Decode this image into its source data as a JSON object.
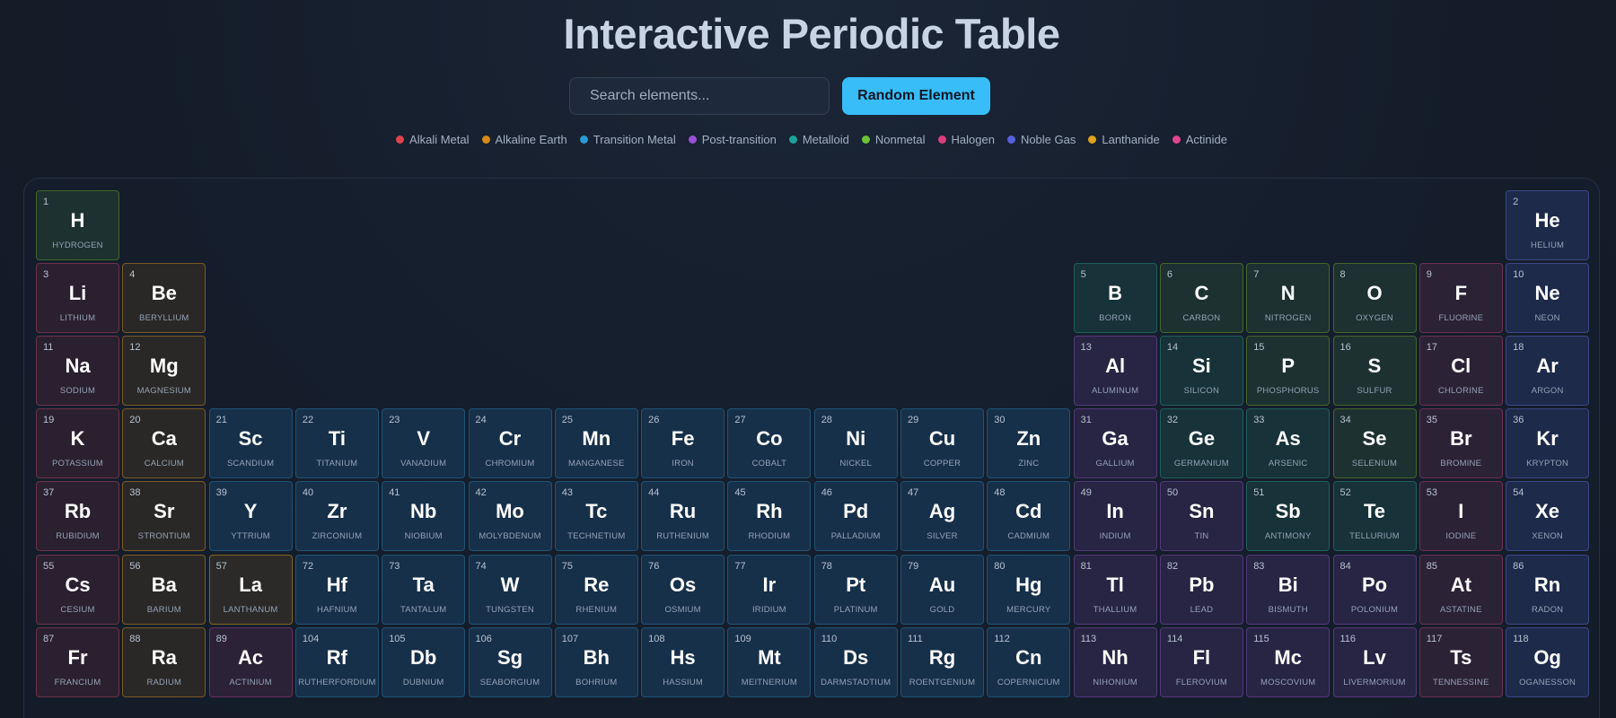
{
  "title": "Interactive Periodic Table",
  "search": {
    "placeholder": "Search elements..."
  },
  "random_button_label": "Random Element",
  "legend": [
    {
      "label": "Alkali Metal",
      "color": "#e0434e"
    },
    {
      "label": "Alkaline Earth",
      "color": "#d68a17"
    },
    {
      "label": "Transition Metal",
      "color": "#2c9ad6"
    },
    {
      "label": "Post-transition",
      "color": "#9b4fd8"
    },
    {
      "label": "Metalloid",
      "color": "#1ba39a"
    },
    {
      "label": "Nonmetal",
      "color": "#6cc23a"
    },
    {
      "label": "Halogen",
      "color": "#db3f7c"
    },
    {
      "label": "Noble Gas",
      "color": "#5560e0"
    },
    {
      "label": "Lanthanide",
      "color": "#e0a21b"
    },
    {
      "label": "Actinide",
      "color": "#e0458e"
    }
  ],
  "elements": [
    {
      "num": "1",
      "sym": "H",
      "name": "HYDROGEN",
      "cat": "nonmetal",
      "row": 1,
      "col": 1
    },
    {
      "num": "2",
      "sym": "He",
      "name": "HELIUM",
      "cat": "noble",
      "row": 1,
      "col": 18
    },
    {
      "num": "3",
      "sym": "Li",
      "name": "LITHIUM",
      "cat": "alkali",
      "row": 2,
      "col": 1
    },
    {
      "num": "4",
      "sym": "Be",
      "name": "BERYLLIUM",
      "cat": "alkaline",
      "row": 2,
      "col": 2
    },
    {
      "num": "5",
      "sym": "B",
      "name": "BORON",
      "cat": "metalloid",
      "row": 2,
      "col": 13
    },
    {
      "num": "6",
      "sym": "C",
      "name": "CARBON",
      "cat": "nonmetal",
      "row": 2,
      "col": 14
    },
    {
      "num": "7",
      "sym": "N",
      "name": "NITROGEN",
      "cat": "nonmetal",
      "row": 2,
      "col": 15
    },
    {
      "num": "8",
      "sym": "O",
      "name": "OXYGEN",
      "cat": "nonmetal",
      "row": 2,
      "col": 16
    },
    {
      "num": "9",
      "sym": "F",
      "name": "FLUORINE",
      "cat": "halogen",
      "row": 2,
      "col": 17
    },
    {
      "num": "10",
      "sym": "Ne",
      "name": "NEON",
      "cat": "noble",
      "row": 2,
      "col": 18
    },
    {
      "num": "11",
      "sym": "Na",
      "name": "SODIUM",
      "cat": "alkali",
      "row": 3,
      "col": 1
    },
    {
      "num": "12",
      "sym": "Mg",
      "name": "MAGNESIUM",
      "cat": "alkaline",
      "row": 3,
      "col": 2
    },
    {
      "num": "13",
      "sym": "Al",
      "name": "ALUMINUM",
      "cat": "post",
      "row": 3,
      "col": 13
    },
    {
      "num": "14",
      "sym": "Si",
      "name": "SILICON",
      "cat": "metalloid",
      "row": 3,
      "col": 14
    },
    {
      "num": "15",
      "sym": "P",
      "name": "PHOSPHORUS",
      "cat": "nonmetal",
      "row": 3,
      "col": 15
    },
    {
      "num": "16",
      "sym": "S",
      "name": "SULFUR",
      "cat": "nonmetal",
      "row": 3,
      "col": 16
    },
    {
      "num": "17",
      "sym": "Cl",
      "name": "CHLORINE",
      "cat": "halogen",
      "row": 3,
      "col": 17
    },
    {
      "num": "18",
      "sym": "Ar",
      "name": "ARGON",
      "cat": "noble",
      "row": 3,
      "col": 18
    },
    {
      "num": "19",
      "sym": "K",
      "name": "POTASSIUM",
      "cat": "alkali",
      "row": 4,
      "col": 1
    },
    {
      "num": "20",
      "sym": "Ca",
      "name": "CALCIUM",
      "cat": "alkaline",
      "row": 4,
      "col": 2
    },
    {
      "num": "21",
      "sym": "Sc",
      "name": "SCANDIUM",
      "cat": "transition",
      "row": 4,
      "col": 3
    },
    {
      "num": "22",
      "sym": "Ti",
      "name": "TITANIUM",
      "cat": "transition",
      "row": 4,
      "col": 4
    },
    {
      "num": "23",
      "sym": "V",
      "name": "VANADIUM",
      "cat": "transition",
      "row": 4,
      "col": 5
    },
    {
      "num": "24",
      "sym": "Cr",
      "name": "CHROMIUM",
      "cat": "transition",
      "row": 4,
      "col": 6
    },
    {
      "num": "25",
      "sym": "Mn",
      "name": "MANGANESE",
      "cat": "transition",
      "row": 4,
      "col": 7
    },
    {
      "num": "26",
      "sym": "Fe",
      "name": "IRON",
      "cat": "transition",
      "row": 4,
      "col": 8
    },
    {
      "num": "27",
      "sym": "Co",
      "name": "COBALT",
      "cat": "transition",
      "row": 4,
      "col": 9
    },
    {
      "num": "28",
      "sym": "Ni",
      "name": "NICKEL",
      "cat": "transition",
      "row": 4,
      "col": 10
    },
    {
      "num": "29",
      "sym": "Cu",
      "name": "COPPER",
      "cat": "transition",
      "row": 4,
      "col": 11
    },
    {
      "num": "30",
      "sym": "Zn",
      "name": "ZINC",
      "cat": "transition",
      "row": 4,
      "col": 12
    },
    {
      "num": "31",
      "sym": "Ga",
      "name": "GALLIUM",
      "cat": "post",
      "row": 4,
      "col": 13
    },
    {
      "num": "32",
      "sym": "Ge",
      "name": "GERMANIUM",
      "cat": "metalloid",
      "row": 4,
      "col": 14
    },
    {
      "num": "33",
      "sym": "As",
      "name": "ARSENIC",
      "cat": "metalloid",
      "row": 4,
      "col": 15
    },
    {
      "num": "34",
      "sym": "Se",
      "name": "SELENIUM",
      "cat": "nonmetal",
      "row": 4,
      "col": 16
    },
    {
      "num": "35",
      "sym": "Br",
      "name": "BROMINE",
      "cat": "halogen",
      "row": 4,
      "col": 17
    },
    {
      "num": "36",
      "sym": "Kr",
      "name": "KRYPTON",
      "cat": "noble",
      "row": 4,
      "col": 18
    },
    {
      "num": "37",
      "sym": "Rb",
      "name": "RUBIDIUM",
      "cat": "alkali",
      "row": 5,
      "col": 1
    },
    {
      "num": "38",
      "sym": "Sr",
      "name": "STRONTIUM",
      "cat": "alkaline",
      "row": 5,
      "col": 2
    },
    {
      "num": "39",
      "sym": "Y",
      "name": "YTTRIUM",
      "cat": "transition",
      "row": 5,
      "col": 3
    },
    {
      "num": "40",
      "sym": "Zr",
      "name": "ZIRCONIUM",
      "cat": "transition",
      "row": 5,
      "col": 4
    },
    {
      "num": "41",
      "sym": "Nb",
      "name": "NIOBIUM",
      "cat": "transition",
      "row": 5,
      "col": 5
    },
    {
      "num": "42",
      "sym": "Mo",
      "name": "MOLYBDENUM",
      "cat": "transition",
      "row": 5,
      "col": 6
    },
    {
      "num": "43",
      "sym": "Tc",
      "name": "TECHNETIUM",
      "cat": "transition",
      "row": 5,
      "col": 7
    },
    {
      "num": "44",
      "sym": "Ru",
      "name": "RUTHENIUM",
      "cat": "transition",
      "row": 5,
      "col": 8
    },
    {
      "num": "45",
      "sym": "Rh",
      "name": "RHODIUM",
      "cat": "transition",
      "row": 5,
      "col": 9
    },
    {
      "num": "46",
      "sym": "Pd",
      "name": "PALLADIUM",
      "cat": "transition",
      "row": 5,
      "col": 10
    },
    {
      "num": "47",
      "sym": "Ag",
      "name": "SILVER",
      "cat": "transition",
      "row": 5,
      "col": 11
    },
    {
      "num": "48",
      "sym": "Cd",
      "name": "CADMIUM",
      "cat": "transition",
      "row": 5,
      "col": 12
    },
    {
      "num": "49",
      "sym": "In",
      "name": "INDIUM",
      "cat": "post",
      "row": 5,
      "col": 13
    },
    {
      "num": "50",
      "sym": "Sn",
      "name": "TIN",
      "cat": "post",
      "row": 5,
      "col": 14
    },
    {
      "num": "51",
      "sym": "Sb",
      "name": "ANTIMONY",
      "cat": "metalloid",
      "row": 5,
      "col": 15
    },
    {
      "num": "52",
      "sym": "Te",
      "name": "TELLURIUM",
      "cat": "metalloid",
      "row": 5,
      "col": 16
    },
    {
      "num": "53",
      "sym": "I",
      "name": "IODINE",
      "cat": "halogen",
      "row": 5,
      "col": 17
    },
    {
      "num": "54",
      "sym": "Xe",
      "name": "XENON",
      "cat": "noble",
      "row": 5,
      "col": 18
    },
    {
      "num": "55",
      "sym": "Cs",
      "name": "CESIUM",
      "cat": "alkali",
      "row": 6,
      "col": 1
    },
    {
      "num": "56",
      "sym": "Ba",
      "name": "BARIUM",
      "cat": "alkaline",
      "row": 6,
      "col": 2
    },
    {
      "num": "57",
      "sym": "La",
      "name": "LANTHANUM",
      "cat": "lanthanide",
      "row": 6,
      "col": 3
    },
    {
      "num": "72",
      "sym": "Hf",
      "name": "HAFNIUM",
      "cat": "transition",
      "row": 6,
      "col": 4
    },
    {
      "num": "73",
      "sym": "Ta",
      "name": "TANTALUM",
      "cat": "transition",
      "row": 6,
      "col": 5
    },
    {
      "num": "74",
      "sym": "W",
      "name": "TUNGSTEN",
      "cat": "transition",
      "row": 6,
      "col": 6
    },
    {
      "num": "75",
      "sym": "Re",
      "name": "RHENIUM",
      "cat": "transition",
      "row": 6,
      "col": 7
    },
    {
      "num": "76",
      "sym": "Os",
      "name": "OSMIUM",
      "cat": "transition",
      "row": 6,
      "col": 8
    },
    {
      "num": "77",
      "sym": "Ir",
      "name": "IRIDIUM",
      "cat": "transition",
      "row": 6,
      "col": 9
    },
    {
      "num": "78",
      "sym": "Pt",
      "name": "PLATINUM",
      "cat": "transition",
      "row": 6,
      "col": 10
    },
    {
      "num": "79",
      "sym": "Au",
      "name": "GOLD",
      "cat": "transition",
      "row": 6,
      "col": 11
    },
    {
      "num": "80",
      "sym": "Hg",
      "name": "MERCURY",
      "cat": "transition",
      "row": 6,
      "col": 12
    },
    {
      "num": "81",
      "sym": "Tl",
      "name": "THALLIUM",
      "cat": "post",
      "row": 6,
      "col": 13
    },
    {
      "num": "82",
      "sym": "Pb",
      "name": "LEAD",
      "cat": "post",
      "row": 6,
      "col": 14
    },
    {
      "num": "83",
      "sym": "Bi",
      "name": "BISMUTH",
      "cat": "post",
      "row": 6,
      "col": 15
    },
    {
      "num": "84",
      "sym": "Po",
      "name": "POLONIUM",
      "cat": "post",
      "row": 6,
      "col": 16
    },
    {
      "num": "85",
      "sym": "At",
      "name": "ASTATINE",
      "cat": "halogen",
      "row": 6,
      "col": 17
    },
    {
      "num": "86",
      "sym": "Rn",
      "name": "RADON",
      "cat": "noble",
      "row": 6,
      "col": 18
    },
    {
      "num": "87",
      "sym": "Fr",
      "name": "FRANCIUM",
      "cat": "alkali",
      "row": 7,
      "col": 1
    },
    {
      "num": "88",
      "sym": "Ra",
      "name": "RADIUM",
      "cat": "alkaline",
      "row": 7,
      "col": 2
    },
    {
      "num": "89",
      "sym": "Ac",
      "name": "ACTINIUM",
      "cat": "actinide",
      "row": 7,
      "col": 3
    },
    {
      "num": "104",
      "sym": "Rf",
      "name": "RUTHERFORDIUM",
      "cat": "transition",
      "row": 7,
      "col": 4
    },
    {
      "num": "105",
      "sym": "Db",
      "name": "DUBNIUM",
      "cat": "transition",
      "row": 7,
      "col": 5
    },
    {
      "num": "106",
      "sym": "Sg",
      "name": "SEABORGIUM",
      "cat": "transition",
      "row": 7,
      "col": 6
    },
    {
      "num": "107",
      "sym": "Bh",
      "name": "BOHRIUM",
      "cat": "transition",
      "row": 7,
      "col": 7
    },
    {
      "num": "108",
      "sym": "Hs",
      "name": "HASSIUM",
      "cat": "transition",
      "row": 7,
      "col": 8
    },
    {
      "num": "109",
      "sym": "Mt",
      "name": "MEITNERIUM",
      "cat": "transition",
      "row": 7,
      "col": 9
    },
    {
      "num": "110",
      "sym": "Ds",
      "name": "DARMSTADTIUM",
      "cat": "transition",
      "row": 7,
      "col": 10
    },
    {
      "num": "111",
      "sym": "Rg",
      "name": "ROENTGENIUM",
      "cat": "transition",
      "row": 7,
      "col": 11
    },
    {
      "num": "112",
      "sym": "Cn",
      "name": "COPERNICIUM",
      "cat": "transition",
      "row": 7,
      "col": 12
    },
    {
      "num": "113",
      "sym": "Nh",
      "name": "NIHONIUM",
      "cat": "post",
      "row": 7,
      "col": 13
    },
    {
      "num": "114",
      "sym": "Fl",
      "name": "FLEROVIUM",
      "cat": "post",
      "row": 7,
      "col": 14
    },
    {
      "num": "115",
      "sym": "Mc",
      "name": "MOSCOVIUM",
      "cat": "post",
      "row": 7,
      "col": 15
    },
    {
      "num": "116",
      "sym": "Lv",
      "name": "LIVERMORIUM",
      "cat": "post",
      "row": 7,
      "col": 16
    },
    {
      "num": "117",
      "sym": "Ts",
      "name": "TENNESSINE",
      "cat": "halogen",
      "row": 7,
      "col": 17
    },
    {
      "num": "118",
      "sym": "Og",
      "name": "OGANESSON",
      "cat": "noble",
      "row": 7,
      "col": 18
    }
  ]
}
